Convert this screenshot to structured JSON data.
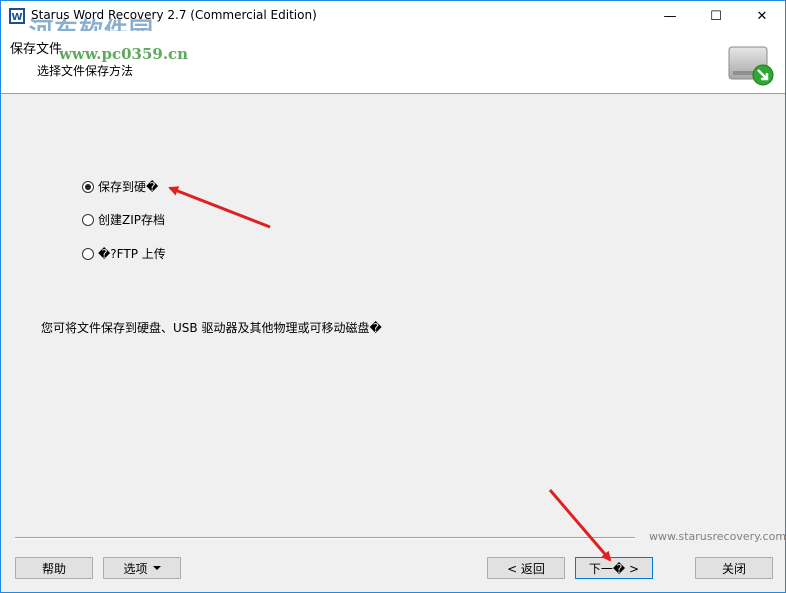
{
  "window": {
    "title": "Starus Word Recovery 2.7 (Commercial Edition)",
    "controls": {
      "minimize": "—",
      "maximize": "☐",
      "close": "✕"
    }
  },
  "watermark": {
    "text": "河东软件园",
    "url": "www.pc0359.cn"
  },
  "header": {
    "title": "保存文件",
    "subtitle": "选择文件保存方法"
  },
  "options": [
    {
      "label": "保存到硬�",
      "checked": true
    },
    {
      "label": "创建ZIP存档",
      "checked": false
    },
    {
      "label": "�?FTP 上传",
      "checked": false
    }
  ],
  "description": "您可将文件保存到硬盘、USB 驱动器及其他物理或可移动磁盘�",
  "footer": {
    "site": "www.starusrecovery.com",
    "help_label": "帮助",
    "options_label": "选项",
    "back_label": "< 返回",
    "next_label": "下一� >",
    "close_label": "关闭"
  },
  "colors": {
    "accent": "#0078d7",
    "arrow": "#e02020",
    "panel": "#f0f0f0"
  }
}
